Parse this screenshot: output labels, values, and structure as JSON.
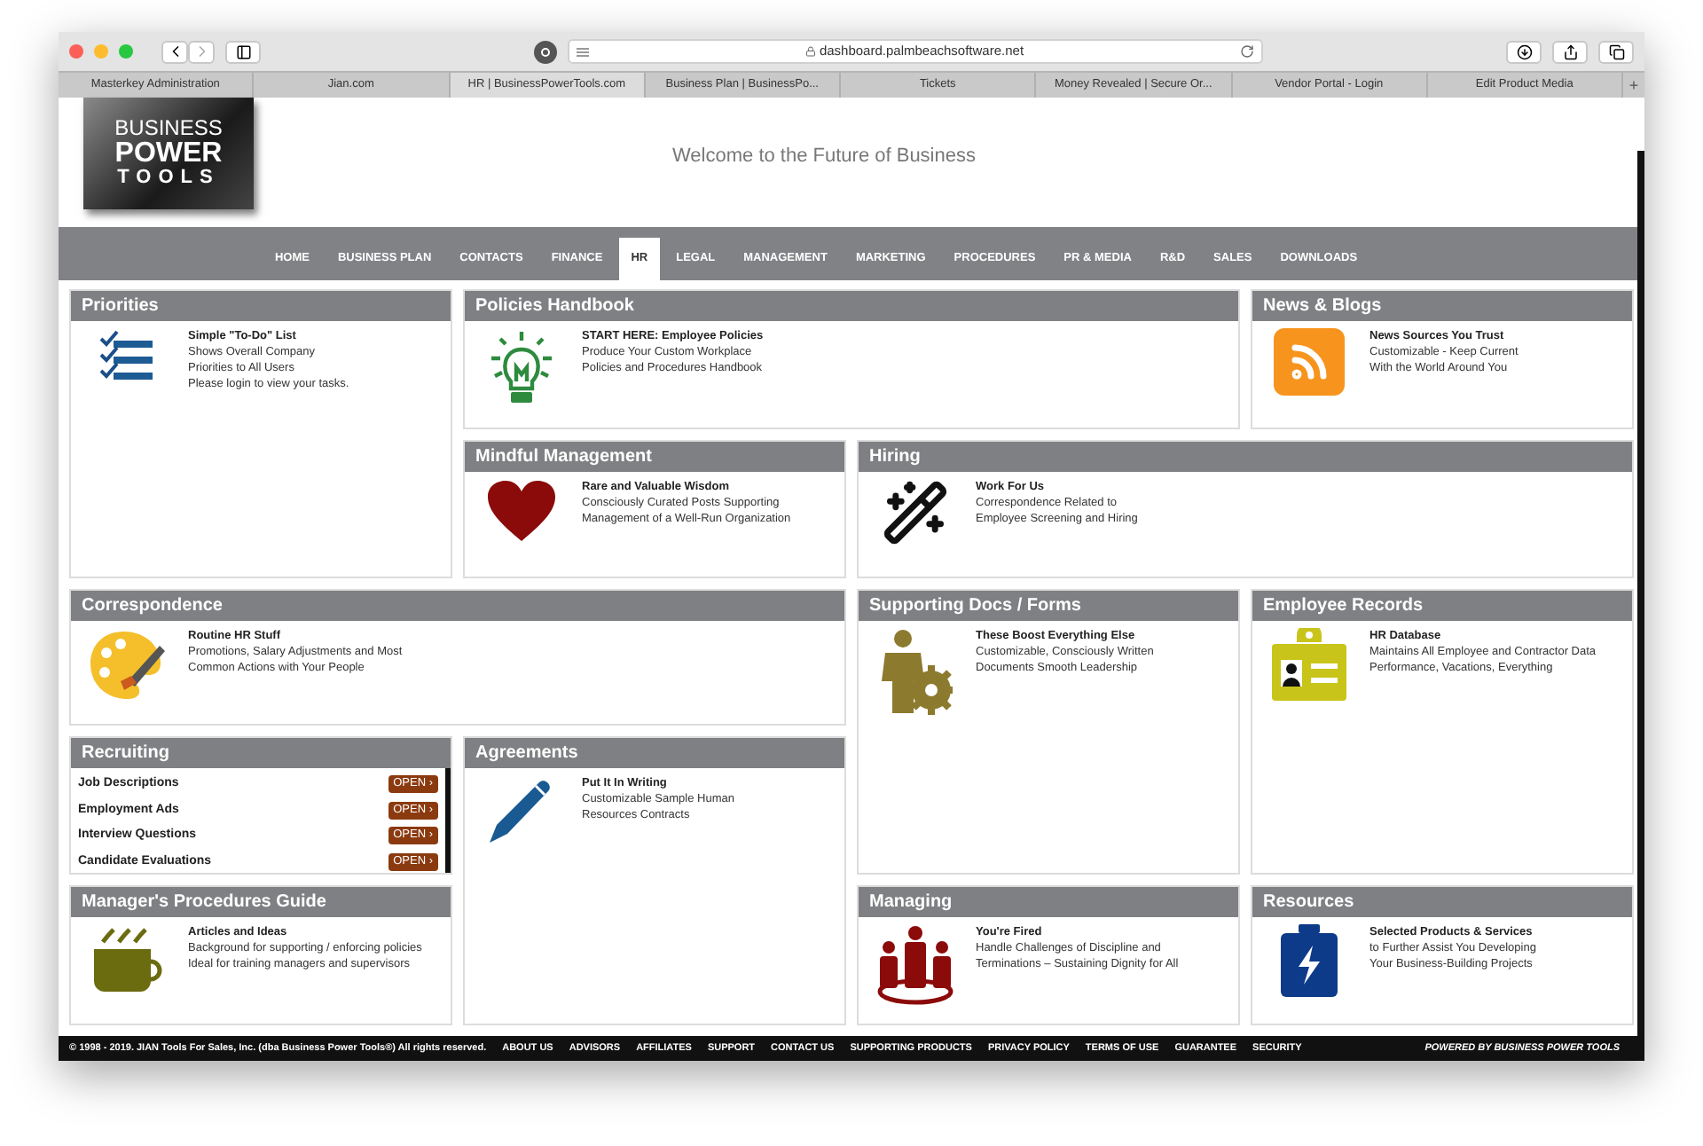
{
  "browser": {
    "url": "dashboard.palmbeachsoftware.net",
    "new_tab": "+",
    "tabs": [
      {
        "label": "Masterkey Administration",
        "selected": false
      },
      {
        "label": "Jian.com",
        "selected": false
      },
      {
        "label": "HR | BusinessPowerTools.com",
        "selected": true
      },
      {
        "label": "Business Plan | BusinessPo...",
        "selected": false
      },
      {
        "label": "Tickets",
        "selected": false
      },
      {
        "label": "Money Revealed | Secure Or...",
        "selected": false
      },
      {
        "label": "Vendor Portal - Login",
        "selected": false
      },
      {
        "label": "Edit Product Media",
        "selected": false
      }
    ]
  },
  "header": {
    "logo": [
      "BUSINESS",
      "POWER",
      "TOOLS"
    ],
    "welcome": "Welcome to the Future of Business"
  },
  "nav": [
    {
      "label": "HOME",
      "selected": false
    },
    {
      "label": "BUSINESS PLAN",
      "selected": false
    },
    {
      "label": "CONTACTS",
      "selected": false
    },
    {
      "label": "FINANCE",
      "selected": false
    },
    {
      "label": "HR",
      "selected": true
    },
    {
      "label": "LEGAL",
      "selected": false
    },
    {
      "label": "MANAGEMENT",
      "selected": false
    },
    {
      "label": "MARKETING",
      "selected": false
    },
    {
      "label": "PROCEDURES",
      "selected": false
    },
    {
      "label": "PR & MEDIA",
      "selected": false
    },
    {
      "label": "R&D",
      "selected": false
    },
    {
      "label": "SALES",
      "selected": false
    },
    {
      "label": "DOWNLOADS",
      "selected": false
    }
  ],
  "cards": [
    {
      "kind": "info",
      "title": "Priorities",
      "heading": "Simple \"To-Do\" List",
      "lines": [
        "Shows Overall Company",
        "Priorities to All Users",
        "Please login to view your tasks."
      ]
    },
    {
      "kind": "info",
      "title": "Policies Handbook",
      "heading": "START HERE: Employee Policies",
      "lines": [
        "Produce Your Custom Workplace",
        "Policies and Procedures Handbook"
      ]
    },
    {
      "kind": "info",
      "title": "News & Blogs",
      "heading": "News Sources You Trust",
      "lines": [
        "Customizable - Keep Current",
        "With the World Around You"
      ]
    },
    {
      "kind": "info",
      "title": "Mindful Management",
      "heading": "Rare and Valuable Wisdom",
      "lines": [
        "Consciously Curated Posts Supporting",
        "Management of a Well-Run Organization"
      ]
    },
    {
      "kind": "info",
      "title": "Hiring",
      "heading": "Work For Us",
      "lines": [
        "Correspondence Related to",
        "Employee Screening and Hiring"
      ]
    },
    {
      "kind": "info",
      "title": "Correspondence",
      "heading": "Routine HR Stuff",
      "lines": [
        "Promotions, Salary Adjustments and Most",
        "Common Actions with Your People"
      ]
    },
    {
      "kind": "info",
      "title": "Supporting Docs / Forms",
      "heading": "These Boost Everything Else",
      "lines": [
        "Customizable, Consciously Written",
        "Documents Smooth Leadership"
      ]
    },
    {
      "kind": "info",
      "title": "Employee Records",
      "heading": "HR Database",
      "lines": [
        "Maintains All Employee and Contractor Data",
        "Performance, Vacations, Everything"
      ]
    },
    {
      "kind": "list",
      "title": "Recruiting",
      "items": [
        {
          "label": "Job Descriptions",
          "button": "OPEN ›"
        },
        {
          "label": "Employment Ads",
          "button": "OPEN ›"
        },
        {
          "label": "Interview Questions",
          "button": "OPEN ›"
        },
        {
          "label": "Candidate Evaluations",
          "button": "OPEN ›"
        }
      ]
    },
    {
      "kind": "info",
      "title": "Agreements",
      "heading": "Put It In Writing",
      "lines": [
        "Customizable Sample Human",
        "Resources Contracts"
      ]
    },
    {
      "kind": "info",
      "title": "Manager's Procedures Guide",
      "heading": "Articles and Ideas",
      "lines": [
        "Background for supporting / enforcing policies",
        "Ideal for training managers and supervisors"
      ]
    },
    {
      "kind": "info",
      "title": "Managing",
      "heading": "You're Fired",
      "lines": [
        "Handle Challenges of Discipline and",
        "Terminations – Sustaining Dignity for All"
      ]
    },
    {
      "kind": "info",
      "title": "Resources",
      "heading": "Selected Products & Services",
      "lines": [
        "to Further Assist You Developing",
        "Your Business-Building Projects"
      ]
    }
  ],
  "footer": {
    "copyright": "© 1998 - 2019. JIAN Tools For Sales, Inc. (dba Business Power Tools®) All rights reserved.",
    "links": [
      "ABOUT US",
      "ADVISORS",
      "AFFILIATES",
      "SUPPORT",
      "CONTACT US",
      "SUPPORTING PRODUCTS",
      "PRIVACY POLICY",
      "TERMS OF USE",
      "GUARANTEE",
      "SECURITY"
    ],
    "powered": "POWERED BY **BUSINESS POWER TOOLS**"
  }
}
